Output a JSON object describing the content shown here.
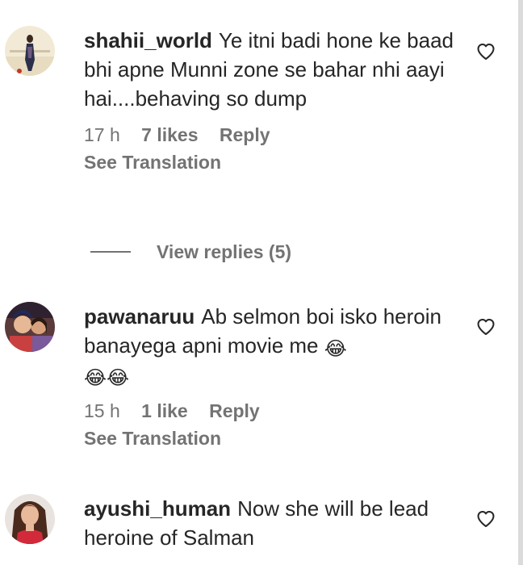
{
  "comments": [
    {
      "username": "shahii_world",
      "text": "Ye itni badi hone ke baad bhi apne Munni zone se bahar nhi aayi hai....behaving so dump",
      "time": "17 h",
      "likes": "7 likes",
      "reply": "Reply",
      "translation": "See Translation",
      "heart_icon": "heart-outline-icon"
    },
    {
      "username": "pawanaruu",
      "text": "Ab selmon boi isko heroin banayega apni movie me",
      "emoji_inline": "😂",
      "emoji_line": "😂😂",
      "time": "15 h",
      "likes": "1 like",
      "reply": "Reply",
      "translation": "See Translation",
      "heart_icon": "heart-outline-icon"
    },
    {
      "username": "ayushi_human",
      "text": "Now she will be lead heroine of Salman",
      "heart_icon": "heart-outline-icon"
    }
  ],
  "view_replies": "View replies (5)",
  "colors": {
    "text": "#262626",
    "muted": "#737373",
    "border": "#dbdbdb"
  }
}
